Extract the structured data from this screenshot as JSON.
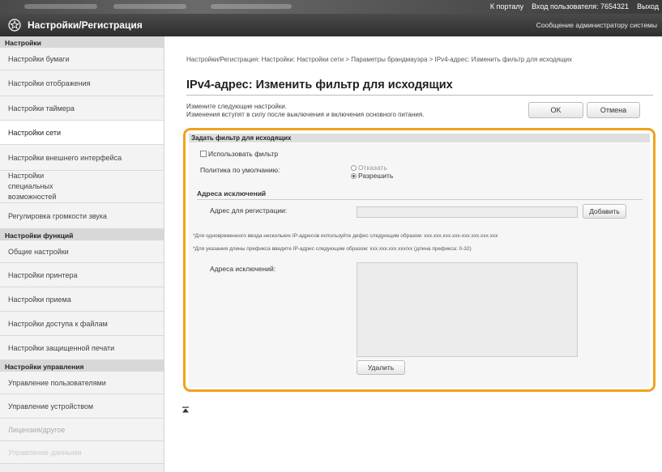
{
  "topbar": {
    "portal_link": "К порталу",
    "login_label": "Вход пользователя:",
    "login_id": "7654321",
    "logout": "Выход"
  },
  "header": {
    "title": "Настройки/Регистрация",
    "admin_message": "Сообщение администратору системы"
  },
  "sidebar": {
    "settings_header": "Настройки",
    "settings_items": [
      "Настройки бумаги",
      "Настройки отображения",
      "Настройки таймера",
      "Настройки сети",
      "Настройки внешнего интерфейса",
      "Настройки специальных возможностей",
      "Регулировка громкости звука"
    ],
    "function_header": "Настройки функций",
    "function_items": [
      "Общие настройки",
      "Настройки принтера",
      "Настройки приема",
      "Настройки доступа к файлам",
      "Настройки защищенной печати"
    ],
    "management_header": "Настройки управления",
    "management_items": [
      "Управление пользователями",
      "Управление устройством",
      "Лицензия/другое",
      "Управление данными"
    ]
  },
  "main": {
    "breadcrumb": "Настройки/Регистрация: Настройки: Настройки сети > Параметры брандмауэра > IPv4-адрес: Изменить фильтр для исходящих",
    "page_title": "IPv4-адрес: Изменить фильтр для исходящих",
    "description_line1": "Измените следующие настройки.",
    "description_line2": "Изменения вступят в силу после выключения и включения основного питания.",
    "ok_button": "OK",
    "cancel_button": "Отмена"
  },
  "filter": {
    "panel_title": "Задать фильтр для исходящих",
    "use_filter_label": "Использовать фильтр",
    "use_filter_checked": false,
    "default_policy_label": "Политика по умолчанию:",
    "policy_options": [
      "Отказать",
      "Разрешить"
    ],
    "policy_selected": "Разрешить",
    "exceptions_section": "Адреса исключений",
    "register_address_label": "Адрес для регистрации:",
    "register_address_value": "",
    "add_button": "Добавить",
    "note_multiple": "*Для одновременного ввода нескольких IP-адресов используйте дефис следующим образом: xxx.xxx.xxx.xxx-xxx.xxx.xxx.xxx",
    "note_prefix": "*Для указания длины префикса введите IP-адрес следующим образом: xxx.xxx.xxx.xxx/xx (длина префикса: 0-32)",
    "exception_addresses_label": "Адреса исключений:",
    "exception_addresses": [],
    "delete_button": "Удалить"
  },
  "colors": {
    "highlight_border": "#f0a21e",
    "header_bg": "#3a3a3a"
  }
}
